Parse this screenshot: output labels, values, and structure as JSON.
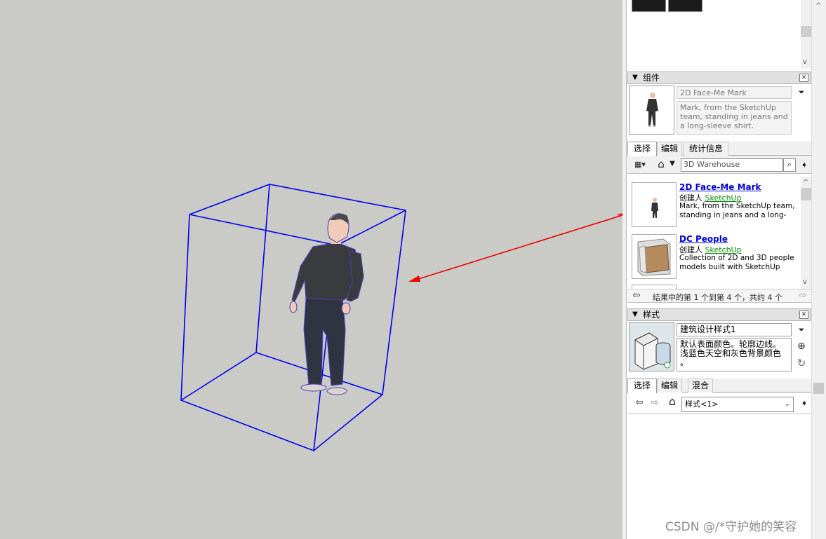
{
  "components_panel": {
    "title": "组件",
    "selected": {
      "name": "2D Face-Me Mark",
      "description": "Mark, from the SketchUp team, standing in jeans and a long-sleeve shirt."
    },
    "tabs": [
      "选择",
      "编辑",
      "统计信息"
    ],
    "search_placeholder": "3D Warehouse",
    "results": [
      {
        "title": "2D Face-Me Mark",
        "by_label": "创建人",
        "author": "SketchUp",
        "desc_line1": "Mark, from the SketchUp team,",
        "desc_line2": "standing in jeans and a long-slee..."
      },
      {
        "title": "DC People",
        "by_label": "创建人",
        "author": "SketchUp",
        "desc_line1": "Collection of 2D and 3D people",
        "desc_line2": "models built with SketchUp Dyna..."
      }
    ],
    "pagination": "结果中的第 1 个到第 4 个，共约 4 个"
  },
  "styles_panel": {
    "title": "样式",
    "style_name": "建筑设计样式1",
    "style_desc_line1": "默认表面颜色。轮廓边线。",
    "style_desc_line2": "浅蓝色天空和灰色背景颜色",
    "style_desc_line3": "。",
    "tabs": [
      "选择",
      "编辑",
      "混合"
    ],
    "collection_select": "样式<1>"
  },
  "watermark": "CSDN @/*守护她的笑容",
  "colors": {
    "viewport_bg": "#cacbc6",
    "bounding_box": "#0000ee",
    "arrow": "#ee0000",
    "link": "#0000cc",
    "author_link": "#0a8a0a"
  },
  "icons": [
    "close-icon",
    "collapse-triangle-icon",
    "details-icon",
    "view-options-icon",
    "home-icon",
    "dropdown-icon",
    "search-icon",
    "back-arrow-icon",
    "forward-arrow-icon",
    "refresh-icon",
    "add-style-icon",
    "chevron-down-icon"
  ]
}
